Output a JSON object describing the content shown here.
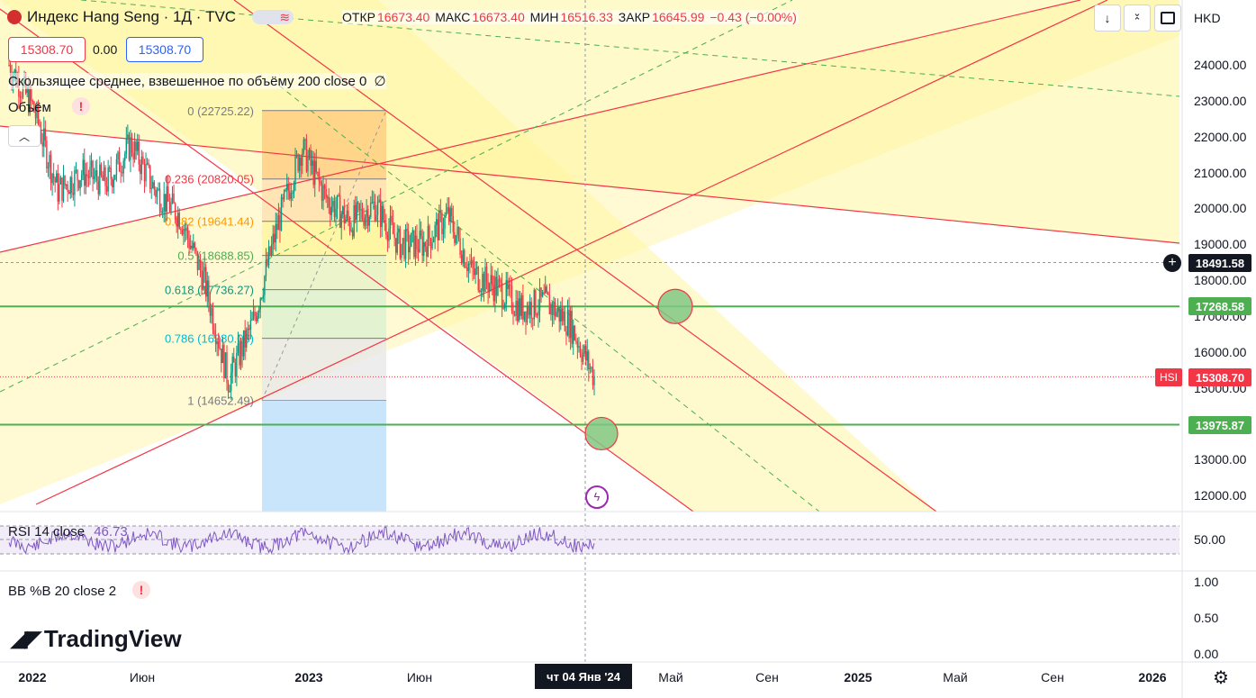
{
  "header": {
    "symbol_name": "Индекс Hang Seng · 1Д · TVC",
    "ohlc": [
      {
        "k": "ОТКР",
        "v": "16673.40"
      },
      {
        "k": "МАКС",
        "v": "16673.40"
      },
      {
        "k": "МИН",
        "v": "16516.33"
      },
      {
        "k": "ЗАКР",
        "v": "16645.99"
      }
    ],
    "change": "−0.43 (−0.00%)",
    "sell_price": "15308.70",
    "spread": "0.00",
    "buy_price": "15308.70",
    "currency": "HKD"
  },
  "indicators": {
    "vwma": "Скользящее среднее, взвешенное по объёму 200 close 0",
    "vwma_extra": "∅",
    "volume": "Объём",
    "rsi_label": "RSI 14 close",
    "rsi_value": "46.73",
    "bb_label": "BB %B 20 close 2",
    "warning": "!"
  },
  "logo": "TradingView",
  "price_tags": {
    "crosshair": "18491.58",
    "level_upper": "17268.58",
    "current": "15308.70",
    "current_symbol": "HSI",
    "level_lower": "13975.87"
  },
  "crosshair_date": "чт 04 Янв '24",
  "colors": {
    "up": "#089981",
    "down": "#f23645",
    "level": "#4caf50",
    "channel": "#f23645",
    "fill": "#fff59d",
    "rsi": "#7e57c2"
  },
  "chart_data": {
    "type": "line",
    "series": [
      {
        "x": [
          "2022-01",
          "2022-02",
          "2022-03",
          "2022-04",
          "2022-05",
          "2022-06",
          "2022-07",
          "2022-08",
          "2022-09",
          "2022-10",
          "2022-11",
          "2022-12",
          "2023-01",
          "2023-02",
          "2023-03",
          "2023-04",
          "2023-05",
          "2023-06",
          "2023-07",
          "2023-08",
          "2023-09",
          "2023-10",
          "2023-11",
          "2023-12",
          "2024-01"
        ],
        "values": [
          24000,
          22800,
          20500,
          21000,
          20700,
          21800,
          20500,
          19800,
          18000,
          15200,
          16800,
          19500,
          21700,
          20300,
          19600,
          20100,
          19000,
          19000,
          19800,
          18200,
          17800,
          17200,
          17400,
          16800,
          15300
        ]
      }
    ],
    "ylim": [
      11500,
      25000
    ],
    "y_ticks": [
      "24000.00",
      "23000.00",
      "22000.00",
      "21000.00",
      "20000.00",
      "19000.00",
      "18000.00",
      "17000.00",
      "16000.00",
      "15000.00",
      "14000.00",
      "13000.00",
      "12000.00"
    ],
    "x_ticks": [
      "2022",
      "Июн",
      "2023",
      "Июн",
      "Май",
      "Сен",
      "2025",
      "Май",
      "Сен",
      "2026"
    ],
    "fib_levels": [
      {
        "ratio": "0",
        "value": "22725.22"
      },
      {
        "ratio": "0.236",
        "value": "20820.05"
      },
      {
        "ratio": "0.382",
        "value": "19641.44"
      },
      {
        "ratio": "0.5",
        "value": "18688.85"
      },
      {
        "ratio": "0.618",
        "value": "17736.27"
      },
      {
        "ratio": "0.786",
        "value": "16380.06"
      },
      {
        "ratio": "1",
        "value": "14652.49"
      }
    ],
    "horizontal_levels": [
      17268.58,
      13975.87
    ],
    "rsi_ticks": [
      "50.00"
    ],
    "bb_ticks": [
      "1.00",
      "0.50",
      "0.00"
    ]
  }
}
